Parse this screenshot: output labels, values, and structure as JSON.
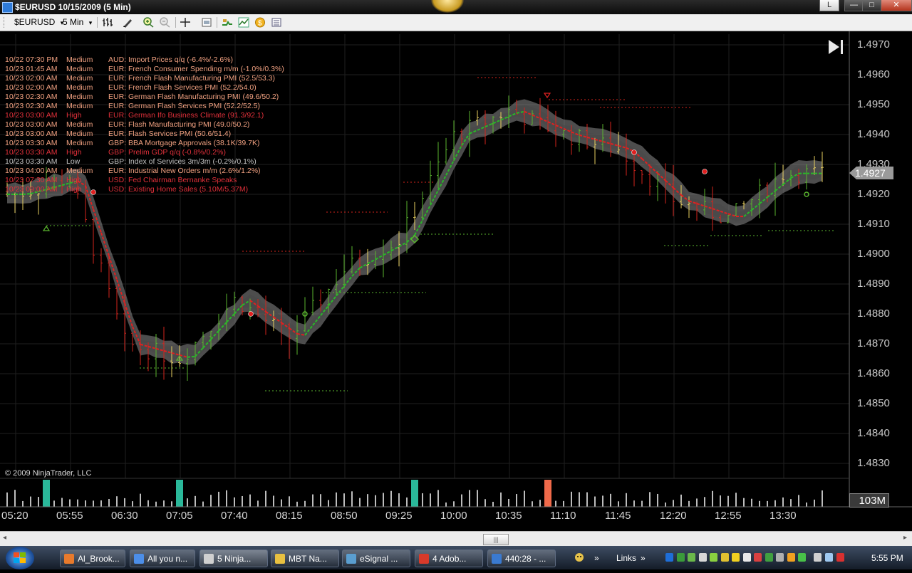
{
  "window": {
    "title": "$EURUSD  10/15/2009 (5 Min)",
    "lang_button": "L",
    "min_symbol": "—",
    "max_symbol": "□",
    "close_symbol": "✕"
  },
  "toolbar": {
    "instrument": "$EURUSD",
    "interval": "5 Min",
    "dropdown_arrow": "▾"
  },
  "news": [
    {
      "time": "10/22 07:30 PM",
      "impact": "Medium",
      "event": "AUD: Import Prices q/q (-6.4%/-2.6%)",
      "color": "#f0a080"
    },
    {
      "time": "10/23 01:45 AM",
      "impact": "Medium",
      "event": "EUR: French Consumer Spending m/m (-1.0%/0.3%)",
      "color": "#f0a080"
    },
    {
      "time": "10/23 02:00 AM",
      "impact": "Medium",
      "event": "EUR: French Flash Manufacturing PMI (52.5/53.3)",
      "color": "#f0a080"
    },
    {
      "time": "10/23 02:00 AM",
      "impact": "Medium",
      "event": "EUR: French Flash Services PMI (52.2/54.0)",
      "color": "#f0a080"
    },
    {
      "time": "10/23 02:30 AM",
      "impact": "Medium",
      "event": "EUR: German Flash Manufacturing PMI (49.6/50.2)",
      "color": "#f0a080"
    },
    {
      "time": "10/23 02:30 AM",
      "impact": "Medium",
      "event": "EUR: German Flash Services PMI (52.2/52.5)",
      "color": "#f0a080"
    },
    {
      "time": "10/23 03:00 AM",
      "impact": "High",
      "event": "EUR: German Ifo Business Climate (91.3/92.1)",
      "color": "#e0303a"
    },
    {
      "time": "10/23 03:00 AM",
      "impact": "Medium",
      "event": "EUR: Flash Manufacturing PMI (49.0/50.2)",
      "color": "#f0a080"
    },
    {
      "time": "10/23 03:00 AM",
      "impact": "Medium",
      "event": "EUR: Flash Services PMI (50.6/51.4)",
      "color": "#f0a080"
    },
    {
      "time": "10/23 03:30 AM",
      "impact": "Medium",
      "event": "GBP: BBA Mortgage Approvals (38.1K/39.7K)",
      "color": "#f0a080"
    },
    {
      "time": "10/23 03:30 AM",
      "impact": "High",
      "event": "GBP: Prelim GDP q/q (-0.8%/0.2%)",
      "color": "#e0303a"
    },
    {
      "time": "10/23 03:30 AM",
      "impact": "Low",
      "event": "GBP: Index of Services 3m/3m (-0.2%/0.1%)",
      "color": "#c0c0c0"
    },
    {
      "time": "10/23 04:00 AM",
      "impact": "Medium",
      "event": "EUR: Industrial New Orders m/m (2.6%/1.2%)",
      "color": "#f0a080"
    },
    {
      "time": "10/23 07:30 AM",
      "impact": "High",
      "event": "USD: Fed Chairman Bernanke Speaks",
      "color": "#e0303a"
    },
    {
      "time": "10/23 09:00 AM",
      "impact": "High",
      "event": "USD: Existing Home Sales (5.10M/5.37M)",
      "color": "#e0303a"
    }
  ],
  "chart": {
    "price_axis": [
      "1.4970",
      "1.4960",
      "1.4950",
      "1.4940",
      "1.4930",
      "1.4920",
      "1.4910",
      "1.4900",
      "1.4890",
      "1.4880",
      "1.4870",
      "1.4860",
      "1.4850",
      "1.4840",
      "1.4830"
    ],
    "current_price": "1.4927",
    "volume_label": "103M",
    "time_axis": [
      "05:20",
      "05:55",
      "06:30",
      "07:05",
      "07:40",
      "08:15",
      "08:50",
      "09:25",
      "10:00",
      "10:35",
      "11:10",
      "11:45",
      "12:20",
      "12:55",
      "13:30"
    ],
    "copyright": "© 2009 NinjaTrader, LLC",
    "colors": {
      "up": "#5ab52e",
      "down": "#d4241c",
      "neutral": "#e8d060",
      "ma_down": "#e02020",
      "ma_up": "#28b828",
      "band": "#8c8c8c",
      "volume": "#bdbdbd",
      "news_volume": "#2ab89a",
      "alert_volume": "#f06a4a"
    }
  },
  "chart_data": {
    "type": "candlestick",
    "title": "$EURUSD  10/15/2009 (5 Min)",
    "ylim": [
      1.4825,
      1.4975
    ],
    "x": [
      "05:20",
      "05:55",
      "06:30",
      "07:05",
      "07:40",
      "08:15",
      "08:50",
      "09:25",
      "10:00",
      "10:35",
      "11:10",
      "11:45",
      "12:20",
      "12:55",
      "13:30"
    ],
    "close": [
      1.492,
      1.4925,
      1.487,
      1.4865,
      1.4885,
      1.4872,
      1.4895,
      1.4905,
      1.494,
      1.4948,
      1.494,
      1.4935,
      1.4918,
      1.4912,
      1.4927
    ],
    "last": 1.4927
  },
  "hscroll": {
    "left": "◂",
    "right": "▸",
    "thumb": "|||"
  },
  "taskbar": {
    "tasks": [
      {
        "label": "Al_Brook...",
        "icon": "#e87a2c"
      },
      {
        "label": "All you n...",
        "icon": "#4c8ee8"
      },
      {
        "label": "5 Ninja...",
        "icon": "#d0d0d0"
      },
      {
        "label": "MBT Na...",
        "icon": "#e8c040"
      },
      {
        "label": "eSignal ...",
        "icon": "#5a9ed0"
      },
      {
        "label": "4 Adob...",
        "icon": "#d83a2a"
      },
      {
        "label": "440:28 - ...",
        "icon": "#3a7ad0"
      }
    ],
    "links": "Links",
    "chevron": "»",
    "clock": "5:55 PM"
  }
}
